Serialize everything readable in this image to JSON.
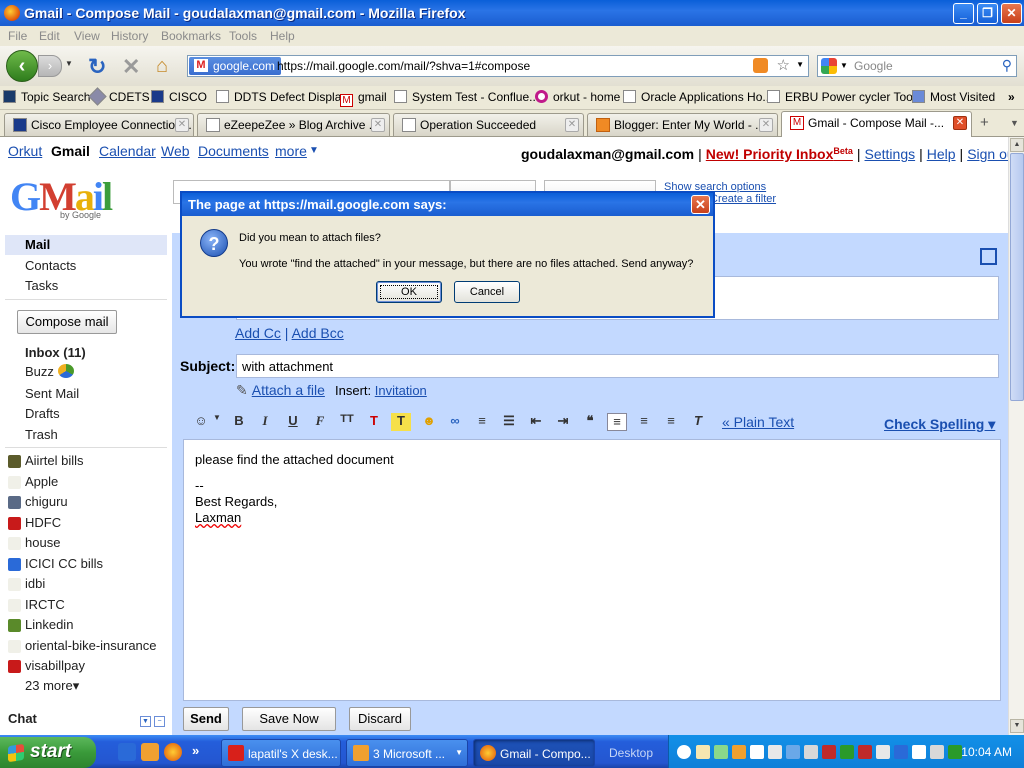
{
  "window": {
    "title": "Gmail - Compose Mail - goudalaxman@gmail.com - Mozilla Firefox",
    "controls": {
      "minimize": "_",
      "maximize": "❐",
      "close": "✕"
    }
  },
  "menu": [
    "File",
    "Edit",
    "View",
    "History",
    "Bookmarks",
    "Tools",
    "Help"
  ],
  "nav": {
    "url_badge": "google.com",
    "url": "https://mail.google.com/mail/?shva=1#compose",
    "search_placeholder": "Google"
  },
  "bookmarks": [
    "Topic Search",
    "CDETS",
    "CISCO",
    "DDTS Defect Display",
    "gmail",
    "System Test - Conflue...",
    "orkut - home",
    "Oracle Applications Ho...",
    "ERBU Power cycler Tool",
    "Most Visited"
  ],
  "tabs": [
    {
      "label": "Cisco Employee Connection...",
      "active": false
    },
    {
      "label": "eZeepeZee » Blog Archive ...",
      "active": false
    },
    {
      "label": "Operation Succeeded",
      "active": false
    },
    {
      "label": "Blogger: Enter My World - ...",
      "active": false
    },
    {
      "label": "Gmail - Compose Mail -...",
      "active": true
    }
  ],
  "gmail": {
    "topnav": [
      "Orkut",
      "Gmail",
      "Calendar",
      "Web",
      "Documents",
      "more"
    ],
    "account": "goudalaxman@gmail.com",
    "priority_inbox": "New! Priority Inbox",
    "beta": "Beta",
    "settings": "Settings",
    "help": "Help",
    "signout": "Sign out",
    "logo_text": [
      "G",
      "M",
      "a",
      "i",
      "l"
    ],
    "by_google": "by Google",
    "show_search_options": "Show search options",
    "filter_link": "Create a filter",
    "sections": [
      "Mail",
      "Contacts",
      "Tasks"
    ],
    "compose_button": "Compose mail",
    "folders": [
      "Inbox (11)",
      "Buzz",
      "Sent Mail",
      "Drafts",
      "Trash"
    ],
    "labels": [
      {
        "name": "Aiirtel bills",
        "color": "#5b5b2b"
      },
      {
        "name": "Apple",
        "color": "#f0f0e8"
      },
      {
        "name": "chiguru",
        "color": "#5a6a86"
      },
      {
        "name": "HDFC",
        "color": "#c81a1a"
      },
      {
        "name": "house",
        "color": "#f0f0e8"
      },
      {
        "name": "ICICI CC bills",
        "color": "#2a6ad8"
      },
      {
        "name": "idbi",
        "color": "#f0f0e8"
      },
      {
        "name": "IRCTC",
        "color": "#f0f0e8"
      },
      {
        "name": "Linkedin",
        "color": "#5a8a2a"
      },
      {
        "name": "oriental-bike-insurance",
        "color": "#f0f0e8"
      },
      {
        "name": "visabillpay",
        "color": "#c81a1a"
      }
    ],
    "more_labels": "23 more▾",
    "chat": "Chat"
  },
  "compose": {
    "add_cc": "Add Cc",
    "add_bcc": "Add Bcc",
    "subject_label": "Subject:",
    "subject_value": "with attachment",
    "attach_link": "Attach a file",
    "insert_label": "Insert:",
    "insert_invitation": "Invitation",
    "plain_text": "« Plain Text",
    "check_spelling": "Check Spelling ▾",
    "body_lines": [
      "please find the attached document",
      "--",
      "Best Regards,",
      "Laxman"
    ],
    "send": "Send",
    "save_now": "Save Now",
    "discard": "Discard"
  },
  "dialog": {
    "title": "The page at https://mail.google.com says:",
    "line1": "Did you mean to attach files?",
    "line2": "You wrote \"find the attached\" in your message, but there are no files attached.  Send anyway?",
    "ok": "OK",
    "cancel": "Cancel"
  },
  "taskbar": {
    "start": "start",
    "tasks": [
      {
        "label": "lapatil's X desk...",
        "active": false
      },
      {
        "label": "3 Microsoft ...",
        "active": false
      },
      {
        "label": "Gmail - Compo...",
        "active": true
      }
    ],
    "desktop": "Desktop",
    "clock": "10:04 AM"
  }
}
